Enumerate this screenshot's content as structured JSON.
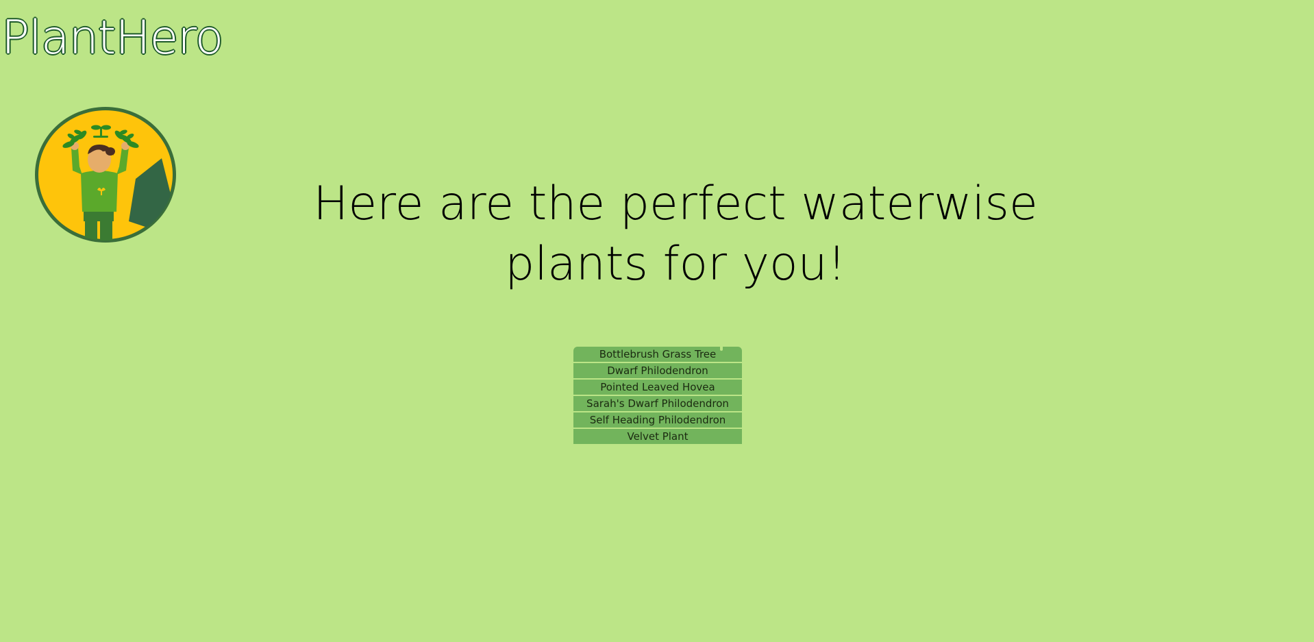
{
  "header": {
    "brand": "PlantHero"
  },
  "logo": {
    "icon": "plant-hero-mascot",
    "colors": {
      "ring": "#3a6e3a",
      "background": "#fec40b",
      "cape": "#336645",
      "suit": "#5ba92b",
      "pants": "#3b7b32",
      "skin": "#e6ad6a",
      "hair": "#4a2e22",
      "leaves": "#2c8a23"
    }
  },
  "main": {
    "headline_line1": "Here are the perfect waterwise",
    "headline_line2": "plants for you!",
    "plants": [
      "Bottlebrush Grass Tree",
      "Dwarf Philodendron",
      "Pointed Leaved Hovea",
      "Sarah's Dwarf Philodendron",
      "Self Heading Philodendron",
      "Velvet Plant"
    ]
  },
  "colors": {
    "page_background": "#bce587",
    "list_item_background": "#72b45c"
  }
}
